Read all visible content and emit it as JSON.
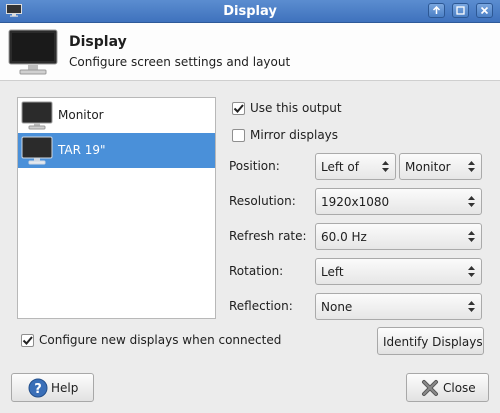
{
  "window": {
    "title": "Display"
  },
  "header": {
    "title": "Display",
    "subtitle": "Configure screen settings and layout"
  },
  "outputs": [
    {
      "label": "Monitor",
      "selected": false
    },
    {
      "label": "TAR 19\"",
      "selected": true
    }
  ],
  "settings": {
    "use_output_label": "Use this output",
    "use_output_checked": true,
    "mirror_label": "Mirror displays",
    "mirror_checked": false,
    "position_label": "Position:",
    "position_value": "Left of",
    "position_target": "Monitor",
    "resolution_label": "Resolution:",
    "resolution_value": "1920x1080",
    "refresh_label": "Refresh rate:",
    "refresh_value": "60.0 Hz",
    "rotation_label": "Rotation:",
    "rotation_value": "Left",
    "reflection_label": "Reflection:",
    "reflection_value": "None"
  },
  "footer": {
    "configure_new_label": "Configure new displays when connected",
    "configure_new_checked": true,
    "identify_label": "Identify Displays",
    "help_label": "Help",
    "close_label": "Close"
  },
  "icons": {
    "app": "monitor-icon",
    "minimize": "minimize-icon",
    "restore": "restore-icon",
    "close": "close-icon",
    "help": "help-icon",
    "close_action": "close-x-icon"
  },
  "colors": {
    "titlebar": "#4a7fc6",
    "selection": "#4a90d9"
  }
}
